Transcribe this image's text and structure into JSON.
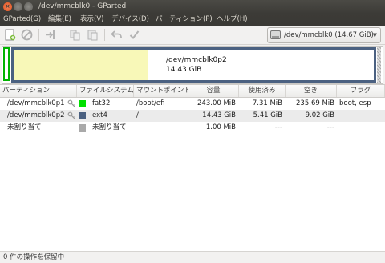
{
  "window": {
    "title": "/dev/mmcblk0 - GParted"
  },
  "menu": [
    "GParted(G)",
    "編集(E)",
    "表示(V)",
    "デバイス(D)",
    "パーティション(P)",
    "ヘルプ(H)"
  ],
  "toolbar": {
    "icons": [
      "new-partition-icon",
      "delete-icon",
      "resize-move-icon",
      "copy-icon",
      "paste-icon",
      "undo-icon",
      "apply-icon"
    ],
    "device_selector": "/dev/mmcblk0  (14.67 GiB)"
  },
  "graphic": {
    "partitions": [
      {
        "name": "/dev/mmcblk0p1",
        "color": "#00b300"
      },
      {
        "name": "/dev/mmcblk0p2",
        "size": "14.43 GiB",
        "color": "#4b6181",
        "used_fraction": 0.375
      },
      {
        "name": "未割り当て",
        "color": "#a9a9a9"
      }
    ]
  },
  "table": {
    "headers": [
      "パーティション",
      "ファイルシステム",
      "マウントポイント",
      "容量",
      "使用済み",
      "空き",
      "フラグ"
    ],
    "rows": [
      {
        "partition": "/dev/mmcblk0p1",
        "fs": "fat32",
        "fs_color": "#00e000",
        "mount": "/boot/efi",
        "size": "243.00 MiB",
        "used": "7.31 MiB",
        "free": "235.69 MiB",
        "flags": "boot, esp",
        "locked": true
      },
      {
        "partition": "/dev/mmcblk0p2",
        "fs": "ext4",
        "fs_color": "#4b6181",
        "mount": "/",
        "size": "14.43 GiB",
        "used": "5.41 GiB",
        "free": "9.02 GiB",
        "flags": "",
        "locked": true
      },
      {
        "partition": "未割り当て",
        "fs": "未割り当て",
        "fs_color": "#a9a9a9",
        "mount": "",
        "size": "1.00 MiB",
        "used": "---",
        "free": "---",
        "flags": "",
        "locked": false
      }
    ]
  },
  "status": {
    "text": "0 件の操作を保留中"
  }
}
